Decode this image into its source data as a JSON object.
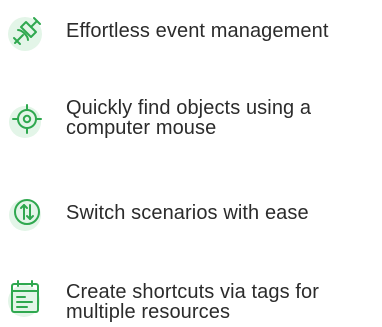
{
  "features": [
    {
      "icon": "satellite-icon",
      "lines": [
        "Effortless event management"
      ]
    },
    {
      "icon": "crosshair-icon",
      "lines": [
        "Quickly find objects using a",
        "computer mouse"
      ]
    },
    {
      "icon": "switch-arrows-icon",
      "lines": [
        "Switch scenarios with ease"
      ]
    },
    {
      "icon": "calendar-list-icon",
      "lines": [
        "Create shortcuts via tags for",
        "multiple resources"
      ]
    }
  ],
  "colors": {
    "icon_stroke": "#2fa84f",
    "icon_bg": "#e3f5e8",
    "text": "#2b2b2b"
  }
}
